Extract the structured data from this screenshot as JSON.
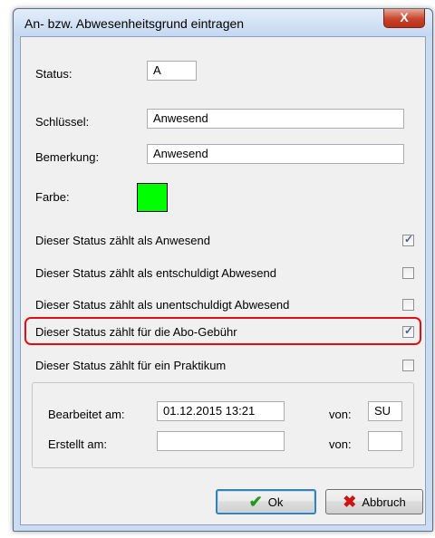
{
  "window": {
    "title": "An- bzw. Abwesenheitsgrund eintragen",
    "close_symbol": "X"
  },
  "form": {
    "status_label": "Status:",
    "status_value": "A",
    "key_label": "Schlüssel:",
    "key_value": "Anwesend",
    "remark_label": "Bemerkung:",
    "remark_value": "Anwesend",
    "color_label": "Farbe:",
    "color_value": "#00ff00"
  },
  "options": [
    {
      "label": "Dieser Status zählt als Anwesend",
      "checked": true
    },
    {
      "label": "Dieser Status zählt als entschuldigt Abwesend",
      "checked": false
    },
    {
      "label": "Dieser Status zählt als unentschuldigt Abwesend",
      "checked": false
    },
    {
      "label": "Dieser Status zählt für die Abo-Gebühr",
      "checked": true
    },
    {
      "label": "Dieser Status zählt für ein Praktikum",
      "checked": false
    }
  ],
  "audit": {
    "edited_label": "Bearbeitet am:",
    "edited_value": "01.12.2015 13:21",
    "edited_by_label": "von:",
    "edited_by_value": "SU",
    "created_label": "Erstellt am:",
    "created_value": "",
    "created_by_label": "von:",
    "created_by_value": ""
  },
  "buttons": {
    "ok_label": "Ok",
    "cancel_label": "Abbruch"
  },
  "highlight_color": "#e01010"
}
